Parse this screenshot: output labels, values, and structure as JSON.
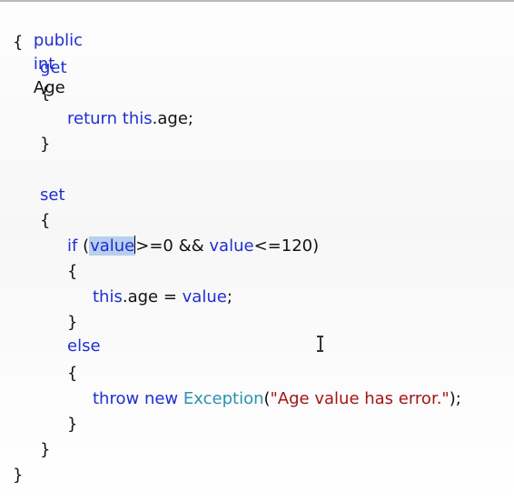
{
  "code": {
    "line1": {
      "kw1": "public",
      "kw2": "int",
      "name": "Age"
    },
    "line2": {
      "brace": "{"
    },
    "line3": {
      "kw": "get"
    },
    "line4": {
      "brace": "{"
    },
    "line5": {
      "kw1": "return",
      "kw2": "this",
      "rest": ".age;"
    },
    "line6": {
      "brace": "}"
    },
    "line7": {
      "kw": "set"
    },
    "line8": {
      "brace": "{"
    },
    "line9": {
      "kw": "if",
      "open": " (",
      "selected": "value",
      "mid": ">=0 && ",
      "kw2": "value",
      "end": "<=120)"
    },
    "line10": {
      "brace": "{"
    },
    "line11": {
      "kw1": "this",
      "mid": ".age = ",
      "kw2": "value",
      "end": ";"
    },
    "line12": {
      "brace": "}"
    },
    "line13": {
      "kw": "else"
    },
    "line14": {
      "brace": "{"
    },
    "line15": {
      "kw1": "throw",
      "kw2": "new",
      "type": "Exception",
      "open": "(",
      "str": "\"Age value has error.\"",
      "end": ");"
    },
    "line16": {
      "brace": "}"
    },
    "line17": {
      "brace": "}"
    },
    "line18": {
      "brace": "}"
    }
  },
  "colors": {
    "keyword": "#1f2fd0",
    "type": "#2b91af",
    "string": "#a31515",
    "selection": "#b8cfee"
  },
  "cursor": {
    "icon": "text-ibeam-cursor-icon"
  }
}
